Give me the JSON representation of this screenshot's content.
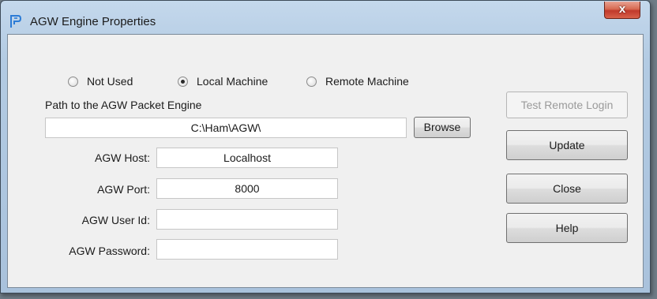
{
  "window": {
    "title": "AGW Engine Properties",
    "close_glyph": "x"
  },
  "icons": {
    "app": "app-logo-icon",
    "close": "close-icon"
  },
  "radio_group": {
    "options": [
      {
        "label": "Not Used",
        "checked": false
      },
      {
        "label": "Local Machine",
        "checked": true
      },
      {
        "label": "Remote Machine",
        "checked": false
      }
    ],
    "selected": "Local Machine"
  },
  "path": {
    "label": "Path to the AGW Packet Engine",
    "value": "C:\\Ham\\AGW\\",
    "browse_label": "Browse"
  },
  "fields": {
    "host": {
      "label": "AGW Host:",
      "value": "Localhost"
    },
    "port": {
      "label": "AGW Port:",
      "value": "8000"
    },
    "user_id": {
      "label": "AGW User Id:",
      "value": ""
    },
    "password": {
      "label": "AGW Password:",
      "value": ""
    }
  },
  "buttons": {
    "test_remote_login": {
      "label": "Test Remote Login",
      "enabled": false
    },
    "update": {
      "label": "Update"
    },
    "close": {
      "label": "Close"
    },
    "help": {
      "label": "Help"
    }
  },
  "colors": {
    "client_background": "#f0f0f0",
    "titlebar": "#b3cbe3",
    "close_button": "#c0392b",
    "app_icon": "#2b7bd6",
    "disabled_text": "#9a9a9a"
  }
}
